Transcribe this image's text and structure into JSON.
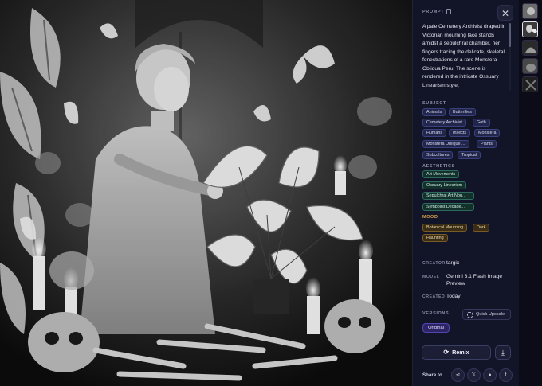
{
  "prompt": {
    "label": "PROMPT",
    "text": "A pale Cemetery Archivist draped in Victorian mourning lace stands amidst a sepulchral chamber, her fingers tracing the delicate, skeletal fenestrations of a rare Monstera Obliqua Peru. The scene is rendered in the intricate Ossuary Linearism style,"
  },
  "sections": {
    "subject_label": "SUBJECT",
    "aesthetics_label": "AESTHETICS",
    "mood_label": "MOOD"
  },
  "subject_tags": [
    "Animals",
    "Butterflies",
    "Cemetery Archivist",
    "Goth",
    "Humans",
    "Insects",
    "Monstera",
    "Monstera Oblique ...",
    "Plants",
    "Subcultures",
    "Tropical"
  ],
  "aesthetic_tags": [
    "Art Movements",
    "Ossuary Linearism",
    "Sepulchral Art Nou...",
    "Symbolist Decade..."
  ],
  "mood_tags": [
    "Botanical Mourning",
    "Dark",
    "Haunting"
  ],
  "meta": {
    "creator_key": "CREATOR",
    "creator_val": "targix",
    "model_key": "MODEL",
    "model_val": "Gemini 3.1 Flash Image Preview",
    "created_key": "CREATED",
    "created_val": "Today"
  },
  "versions": {
    "label": "VERSIONS",
    "quick_upscale": "Quick Upscale",
    "original": "Original"
  },
  "actions": {
    "remix": "Remix",
    "share_label": "Share to"
  },
  "icons": {
    "close": "close-icon",
    "copy": "copy-icon",
    "remix": "refresh-icon",
    "download": "download-icon",
    "share": [
      "share-icon",
      "x-icon",
      "reddit-icon",
      "facebook-icon"
    ]
  },
  "colors": {
    "panel_bg": "#121427",
    "subject_tag": "#22264a",
    "aesthetic_tag": "#13302b",
    "mood_tag": "#3a2d15",
    "mood_label": "#d3a24c",
    "version_pill": "#2d2466"
  }
}
